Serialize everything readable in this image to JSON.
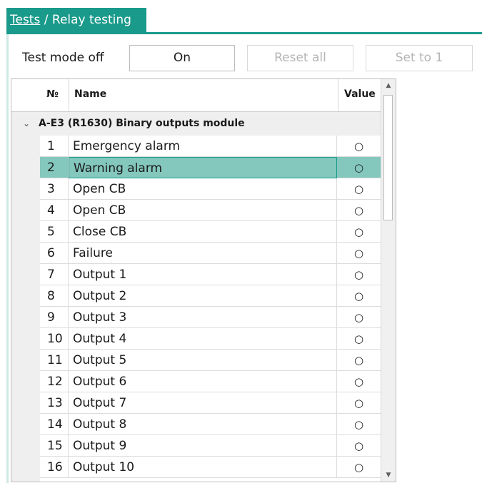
{
  "breadcrumb": {
    "link": "Tests",
    "separator": " / ",
    "current": "Relay testing"
  },
  "toolbar": {
    "mode_label": "Test mode off",
    "on_button": "On",
    "reset_button": "Reset all",
    "set_button": "Set to 1"
  },
  "grid": {
    "columns": [
      "№",
      "Name",
      "Value"
    ],
    "group": {
      "expand_icon": "chevron-down-icon",
      "chevron": "⌄",
      "title": "A-E3 (R1630) Binary outputs module"
    },
    "selected_row": 2,
    "rows": [
      {
        "num": "1",
        "name": "Emergency alarm",
        "value": "○"
      },
      {
        "num": "2",
        "name": "Warning alarm",
        "value": "○"
      },
      {
        "num": "3",
        "name": "Open CB",
        "value": "○"
      },
      {
        "num": "4",
        "name": "Open CB",
        "value": "○"
      },
      {
        "num": "5",
        "name": "Close CB",
        "value": "○"
      },
      {
        "num": "6",
        "name": "Failure",
        "value": "○"
      },
      {
        "num": "7",
        "name": "Output 1",
        "value": "○"
      },
      {
        "num": "8",
        "name": "Output 2",
        "value": "○"
      },
      {
        "num": "9",
        "name": "Output 3",
        "value": "○"
      },
      {
        "num": "10",
        "name": "Output 4",
        "value": "○"
      },
      {
        "num": "11",
        "name": "Output 5",
        "value": "○"
      },
      {
        "num": "12",
        "name": "Output 6",
        "value": "○"
      },
      {
        "num": "13",
        "name": "Output 7",
        "value": "○"
      },
      {
        "num": "14",
        "name": "Output 8",
        "value": "○"
      },
      {
        "num": "15",
        "name": "Output 9",
        "value": "○"
      },
      {
        "num": "16",
        "name": "Output 10",
        "value": "○"
      }
    ]
  },
  "colors": {
    "accent": "#1a9a8b",
    "selection": "#83c7bd",
    "group_bg": "#efefef"
  }
}
